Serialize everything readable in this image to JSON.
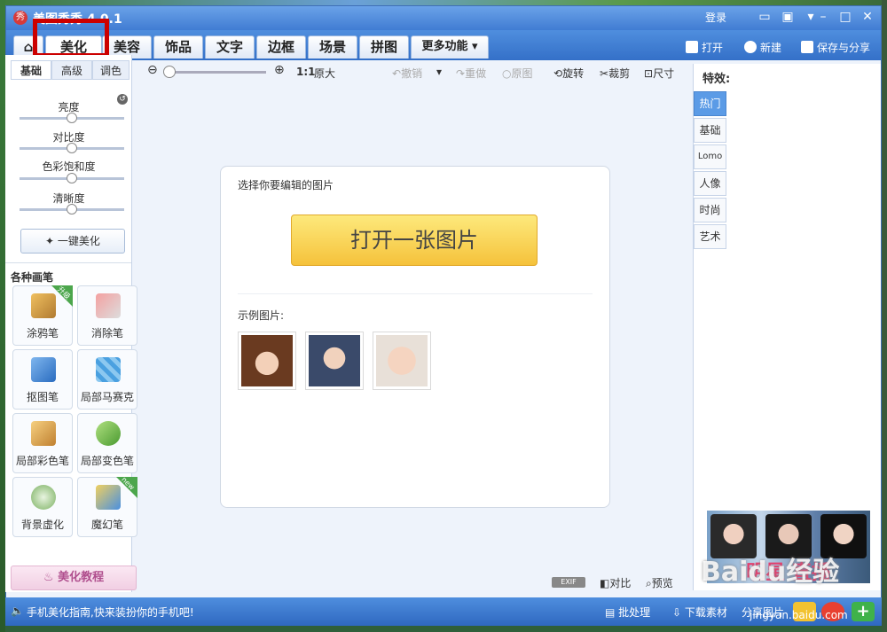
{
  "window": {
    "title": "美图秀秀 4.0.1",
    "logo": "秀"
  },
  "titlebar": {
    "login": "登录"
  },
  "tabs": [
    {
      "label": ""
    },
    {
      "label": "美化"
    },
    {
      "label": "美容"
    },
    {
      "label": "饰品"
    },
    {
      "label": "文字"
    },
    {
      "label": "边框"
    },
    {
      "label": "场景"
    },
    {
      "label": "拼图"
    },
    {
      "label": "更多功能"
    }
  ],
  "top_actions": {
    "open": "打开",
    "new": "新建",
    "save_share": "保存与分享"
  },
  "left": {
    "subtabs": [
      "基础",
      "高级",
      "调色"
    ],
    "sliders": [
      {
        "label": "亮度",
        "value": 0.5
      },
      {
        "label": "对比度",
        "value": 0.5
      },
      {
        "label": "色彩饱和度",
        "value": 0.5
      },
      {
        "label": "清晰度",
        "value": 0.5
      }
    ],
    "one_click": "一键美化",
    "brush_title": "各种画笔",
    "tools": [
      {
        "label": "涂鸦笔",
        "badge": "升级"
      },
      {
        "label": "消除笔",
        "badge": ""
      },
      {
        "label": "抠图笔",
        "badge": ""
      },
      {
        "label": "局部马赛克",
        "badge": ""
      },
      {
        "label": "局部彩色笔",
        "badge": ""
      },
      {
        "label": "局部变色笔",
        "badge": ""
      },
      {
        "label": "背景虚化",
        "badge": ""
      },
      {
        "label": "魔幻笔",
        "badge": "new"
      }
    ],
    "tutorial": "美化教程"
  },
  "toolbar": {
    "ratio": "1:1",
    "original_size": "原大",
    "undo": "撤销",
    "redo": "重做",
    "original": "原图",
    "rotate": "旋转",
    "crop": "裁剪",
    "size": "尺寸"
  },
  "canvas": {
    "choose_label": "选择你要编辑的图片",
    "open_button": "打开一张图片",
    "sample_label": "示例图片:"
  },
  "right": {
    "title": "特效:",
    "tabs": [
      "热门",
      "基础",
      "Lomo",
      "人像",
      "时尚",
      "艺术"
    ],
    "promo_text": "明星 直播"
  },
  "view": {
    "exif": "EXIF",
    "compare": "对比",
    "preview": "预览"
  },
  "status": {
    "message": "手机美化指南,快来装扮你的手机吧!",
    "batch": "批处理",
    "download": "下载素材",
    "share": "分享图片"
  },
  "watermark": {
    "text": "Baidu经验",
    "url": "jingyan.baidu.com"
  }
}
